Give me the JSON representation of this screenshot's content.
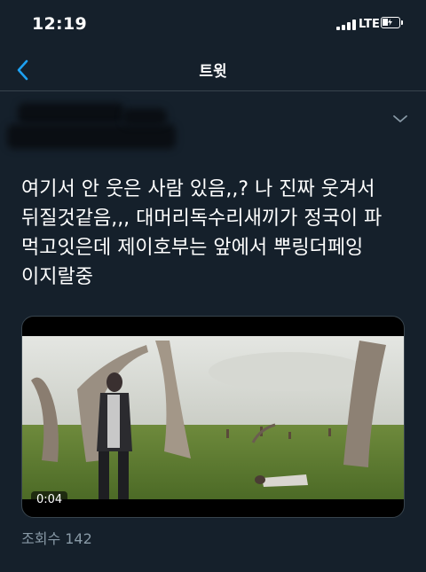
{
  "status": {
    "time": "12:19",
    "network": "LTE",
    "icons": [
      "signal-icon",
      "battery-charging-icon"
    ]
  },
  "nav": {
    "title": "트윗",
    "back_icon": "chevron-left-icon"
  },
  "tweet": {
    "author_redacted": true,
    "menu_icon": "chevron-down-icon",
    "text": "여기서 안 웃은 사람 있음,,? 나 진짜 웃겨서\n뒤질것같음,,, 대머리독수리새끼가 정국이 파\n먹고잇은데 제이호부는 앞에서 뿌링더페잉\n이지랄중",
    "media": {
      "type": "video",
      "duration": "0:04"
    },
    "view_count": "조회수 142"
  },
  "colors": {
    "background": "#15202b",
    "accent": "#1da1f2",
    "secondary_text": "#8899a6",
    "divider": "#38444d"
  }
}
